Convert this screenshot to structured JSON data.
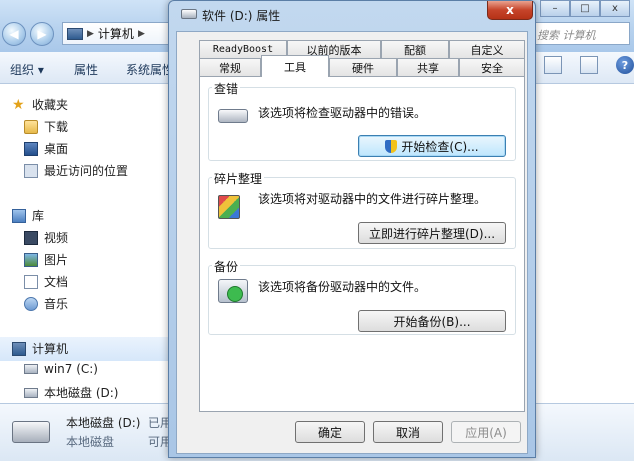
{
  "explorer": {
    "address_text": "计算机",
    "search_placeholder": "搜索 计算机",
    "toolbar": {
      "organize": "组织 ▾",
      "properties": "属性",
      "system_properties": "系统属性"
    },
    "sidebar": {
      "favorites": "收藏夹",
      "downloads": "下载",
      "desktop": "桌面",
      "recent": "最近访问的位置",
      "libraries": "库",
      "videos": "视频",
      "pictures": "图片",
      "documents": "文档",
      "music": "音乐",
      "computer": "计算机",
      "drive_c": "win7 (C:)",
      "drive_d": "本地磁盘 (D:)"
    },
    "status": {
      "drive_name": "本地磁盘 (D:)",
      "used_label": "已用",
      "drive_type": "本地磁盘",
      "free_label": "可用"
    }
  },
  "dialog": {
    "title": "软件 (D:) 属性",
    "close_label": "x",
    "tabs_row1": [
      "ReadyBoost",
      "以前的版本",
      "配额",
      "自定义"
    ],
    "tabs_row2": [
      "常规",
      "工具",
      "硬件",
      "共享",
      "安全"
    ],
    "active_tab": "工具",
    "error_check": {
      "title": "查错",
      "description": "该选项将检查驱动器中的错误。",
      "button": "开始检查(C)..."
    },
    "defrag": {
      "title": "碎片整理",
      "description": "该选项将对驱动器中的文件进行碎片整理。",
      "button": "立即进行碎片整理(D)..."
    },
    "backup": {
      "title": "备份",
      "description": "该选项将备份驱动器中的文件。",
      "button": "开始备份(B)..."
    },
    "buttons": {
      "ok": "确定",
      "cancel": "取消",
      "apply": "应用(A)"
    }
  }
}
